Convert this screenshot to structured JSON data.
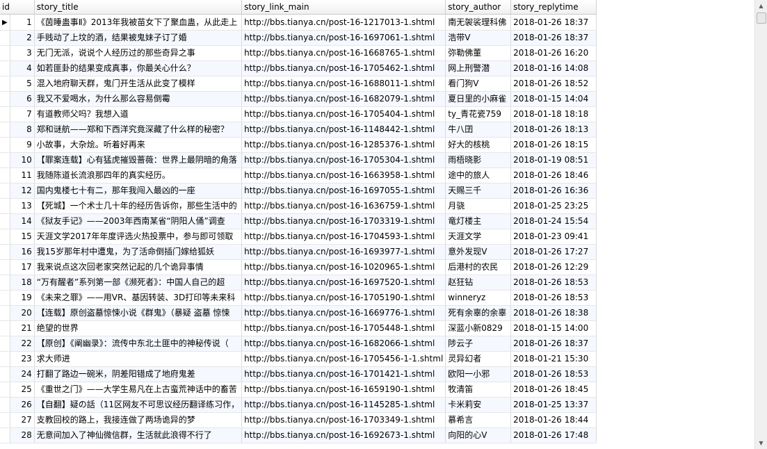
{
  "columns": [
    "id",
    "story_title",
    "story_link_main",
    "story_author",
    "story_replytime"
  ],
  "current_row_marker": "▶",
  "rows": [
    {
      "id": "1",
      "title": "《茵睡蛊事Ⅱ》2013年我被苗女下了聚血蛊，从此走上",
      "link": "http://bbs.tianya.cn/post-16-1217013-1.shtml",
      "author": "南无袈裟理科佛",
      "time": "2018-01-26 18:37"
    },
    {
      "id": "2",
      "title": "手贱动了上坟的酒，结果被鬼妹子订了婚",
      "link": "http://bbs.tianya.cn/post-16-1697061-1.shtml",
      "author": "浩带V",
      "time": "2018-01-26 18:37"
    },
    {
      "id": "3",
      "title": "无门无派，说说个人经历过的那些奇异之事",
      "link": "http://bbs.tianya.cn/post-16-1668765-1.shtml",
      "author": "弥勒佛董",
      "time": "2018-01-26 16:20"
    },
    {
      "id": "4",
      "title": "如若匪卦的结果变成真事，你最关心什么？",
      "link": "http://bbs.tianya.cn/post-16-1705462-1.shtml",
      "author": "网上刑警潜",
      "time": "2018-01-16 14:08"
    },
    {
      "id": "5",
      "title": "混入地府聊天群，鬼门开生活从此变了模样",
      "link": "http://bbs.tianya.cn/post-16-1688011-1.shtml",
      "author": "看门狗V",
      "time": "2018-01-26 18:52"
    },
    {
      "id": "6",
      "title": "我又不爱喝水，为什么那么容易倒霉",
      "link": "http://bbs.tianya.cn/post-16-1682079-1.shtml",
      "author": "夏日里的小麻雀",
      "time": "2018-01-15 14:04"
    },
    {
      "id": "7",
      "title": "有道教师父吗？我想入道",
      "link": "http://bbs.tianya.cn/post-16-1705404-1.shtml",
      "author": "ty_青花瓷759",
      "time": "2018-01-18 18:18"
    },
    {
      "id": "8",
      "title": "郑和谜航——郑和下西洋究竟深藏了什么样的秘密？",
      "link": "http://bbs.tianya.cn/post-16-1148442-1.shtml",
      "author": "牛八囝",
      "time": "2018-01-26 18:13"
    },
    {
      "id": "9",
      "title": "小故事，大杂烩。听着好再来",
      "link": "http://bbs.tianya.cn/post-16-1285376-1.shtml",
      "author": "好大的核桃",
      "time": "2018-01-26 18:15"
    },
    {
      "id": "10",
      "title": "【罪案连载】心有猛虎摧毁蔷薇：世界上最阴暗的角落",
      "link": "http://bbs.tianya.cn/post-16-1705304-1.shtml",
      "author": "雨梧晓影",
      "time": "2018-01-19 08:51"
    },
    {
      "id": "11",
      "title": "我随陈道长流浪那四年的真实经历。",
      "link": "http://bbs.tianya.cn/post-16-1663958-1.shtml",
      "author": "途中的旅人",
      "time": "2018-01-26 18:46"
    },
    {
      "id": "12",
      "title": "国内鬼楼七十有二，那年我闯入最凶的一座",
      "link": "http://bbs.tianya.cn/post-16-1697055-1.shtml",
      "author": "天赐三千",
      "time": "2018-01-26 16:36"
    },
    {
      "id": "13",
      "title": "【死城】一个术士几十年的经历告诉你，那些生活中的",
      "link": "http://bbs.tianya.cn/post-16-1636759-1.shtml",
      "author": "月骁",
      "time": "2018-01-25 23:25"
    },
    {
      "id": "14",
      "title": "《狱友手记》——2003年西南某省“阴阳人俑”调查",
      "link": "http://bbs.tianya.cn/post-16-1703319-1.shtml",
      "author": "竜灯楼主",
      "time": "2018-01-24 15:54"
    },
    {
      "id": "15",
      "title": "天涯文学2017年年度评选火热投票中，参与即可领取",
      "link": "http://bbs.tianya.cn/post-16-1704593-1.shtml",
      "author": "天涯文学",
      "time": "2018-01-23 09:41"
    },
    {
      "id": "16",
      "title": "我15岁那年村中遭鬼，为了活命倒插门嫁给狐妖",
      "link": "http://bbs.tianya.cn/post-16-1693977-1.shtml",
      "author": "意外发现V",
      "time": "2018-01-26 17:27"
    },
    {
      "id": "17",
      "title": "我来说点这次回老家突然记起的几个诡异事情",
      "link": "http://bbs.tianya.cn/post-16-1020965-1.shtml",
      "author": "后港村的农民",
      "time": "2018-01-26 12:29"
    },
    {
      "id": "18",
      "title": "“万有醒者”系列第一部《濒死者》：中国人自己的超",
      "link": "http://bbs.tianya.cn/post-16-1697520-1.shtml",
      "author": "赵狂钻",
      "time": "2018-01-26 18:53"
    },
    {
      "id": "19",
      "title": "《未来之罪》——用VR、基因转装、3D打印等未来科",
      "link": "http://bbs.tianya.cn/post-16-1705190-1.shtml",
      "author": "winneryz",
      "time": "2018-01-26 18:53"
    },
    {
      "id": "20",
      "title": "【连载】原创盗墓惊悚小说《群鬼》（暴疑 盗墓 惊悚",
      "link": "http://bbs.tianya.cn/post-16-1669776-1.shtml",
      "author": "死有余辜的余辜",
      "time": "2018-01-26 18:38"
    },
    {
      "id": "21",
      "title": "绝望的世界",
      "link": "http://bbs.tianya.cn/post-16-1705448-1.shtml",
      "author": "深蓝小新0829",
      "time": "2018-01-15 14:00"
    },
    {
      "id": "22",
      "title": "【原创】《阐幽录》：流传中东北土匪中的神秘传说（",
      "link": "http://bbs.tianya.cn/post-16-1682066-1.shtml",
      "author": "陟云子",
      "time": "2018-01-26 18:37"
    },
    {
      "id": "23",
      "title": "求大师进",
      "link": "http://bbs.tianya.cn/post-16-1705456-1-1.shtml",
      "author": "灵异幻者",
      "time": "2018-01-21 15:30"
    },
    {
      "id": "24",
      "title": "打翻了路边一碗米，阴差阳错成了地府鬼差",
      "link": "http://bbs.tianya.cn/post-16-1701421-1.shtml",
      "author": "欧阳一小邪",
      "time": "2018-01-26 18:53"
    },
    {
      "id": "25",
      "title": "《重世之门》——大学生易凡在上古蛮荒神话中的畜苦",
      "link": "http://bbs.tianya.cn/post-16-1659190-1.shtml",
      "author": "牧清笛",
      "time": "2018-01-26 18:45"
    },
    {
      "id": "26",
      "title": "【自翻】疑の話（11区网友不可思议经历翻译练习作，",
      "link": "http://bbs.tianya.cn/post-16-1145285-1.shtml",
      "author": "卡米莉安",
      "time": "2018-01-25 13:37"
    },
    {
      "id": "27",
      "title": "支教回校的路上，我接连做了两场诡异的梦",
      "link": "http://bbs.tianya.cn/post-16-1703349-1.shtml",
      "author": "慕希言",
      "time": "2018-01-26 18:44"
    },
    {
      "id": "28",
      "title": "无意间加入了神仙微信群，生活就此浪得不行了",
      "link": "http://bbs.tianya.cn/post-16-1692673-1.shtml",
      "author": "向阳的心V",
      "time": "2018-01-26 17:48"
    }
  ]
}
